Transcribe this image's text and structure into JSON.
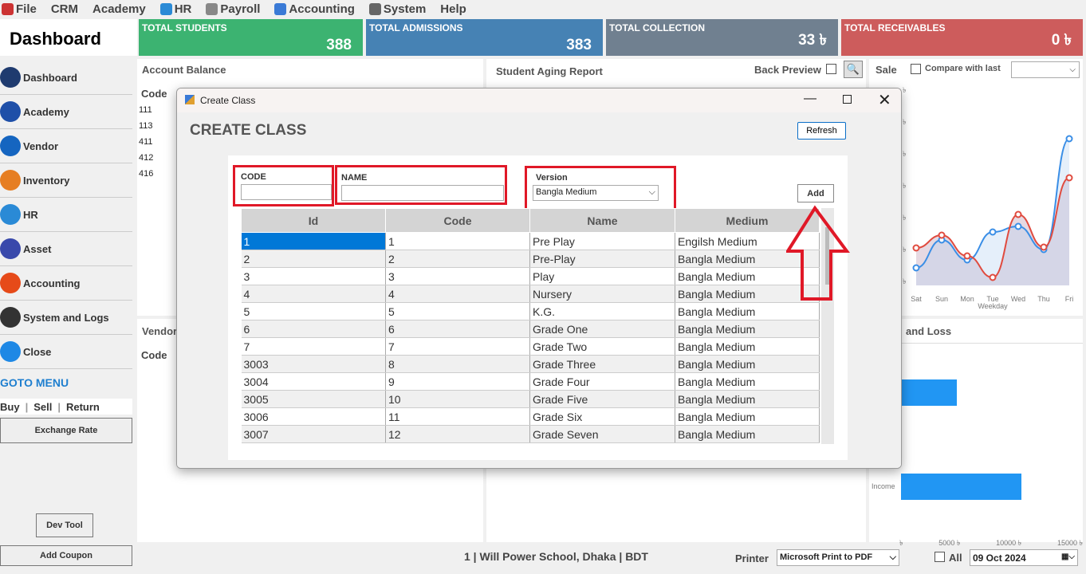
{
  "menu": [
    {
      "label": "File",
      "icon": "file-icon",
      "color": "#c33"
    },
    {
      "label": "CRM",
      "icon": "",
      "color": ""
    },
    {
      "label": "Academy",
      "icon": "",
      "color": ""
    },
    {
      "label": "HR",
      "icon": "hr-icon",
      "color": "#2a8ad6"
    },
    {
      "label": "Payroll",
      "icon": "payroll-icon",
      "color": "#888"
    },
    {
      "label": "Accounting",
      "icon": "accounting-icon",
      "color": "#3a7ad6"
    },
    {
      "label": "System",
      "icon": "system-icon",
      "color": "#666"
    },
    {
      "label": "Help",
      "icon": "",
      "color": ""
    }
  ],
  "dashboard_title": "Dashboard",
  "tiles": [
    {
      "label": "TOTAL STUDENTS",
      "value": "388",
      "color": "#3cb371"
    },
    {
      "label": "TOTAL ADMISSIONS",
      "value": "383",
      "color": "#4682b4"
    },
    {
      "label": "TOTAL COLLECTION",
      "value": "33 ৳",
      "color": "#708090"
    },
    {
      "label": "TOTAL RECEIVABLES",
      "value": "0 ৳",
      "color": "#cd5c5c"
    }
  ],
  "sidebar": [
    {
      "label": "Dashboard",
      "icon": "dashboard-icon",
      "color": "#1f3b6f"
    },
    {
      "label": "Academy",
      "icon": "academy-icon",
      "color": "#1e4fa8"
    },
    {
      "label": "Vendor",
      "icon": "vendor-icon",
      "color": "#1565c0"
    },
    {
      "label": "Inventory",
      "icon": "inventory-icon",
      "color": "#e67e22"
    },
    {
      "label": "HR",
      "icon": "hr-icon",
      "color": "#2a8ad6"
    },
    {
      "label": "Asset",
      "icon": "asset-icon",
      "color": "#3949ab"
    },
    {
      "label": "Accounting",
      "icon": "accounting-icon",
      "color": "#e64a19"
    },
    {
      "label": "System and Logs",
      "icon": "gear-icon",
      "color": "#333"
    },
    {
      "label": "Close",
      "icon": "close-icon",
      "color": "#1e88e5"
    }
  ],
  "goto_menu": "GOTO MENU",
  "goto_links": [
    "Buy",
    "Sell",
    "Return"
  ],
  "exchange_rate": "Exchange Rate",
  "dev_tool": "Dev Tool",
  "add_coupon": "Add Coupon",
  "account_balance": {
    "title": "Account Balance",
    "col": "Code",
    "codes": [
      "111",
      "113",
      "411",
      "412",
      "416"
    ]
  },
  "vendor_panel": {
    "title": "Vendor",
    "col": "Code"
  },
  "aging": {
    "title": "Student Aging Report",
    "back_preview": "Back Preview"
  },
  "sale": {
    "label": "Sale",
    "compare": "Compare with last"
  },
  "chart_weekdays": [
    "Sat",
    "Sun",
    "Mon",
    "Tue",
    "Wed",
    "Thu",
    "Fri"
  ],
  "chart_axis": "Weekday",
  "chart_currency": "৳",
  "profit_loss": {
    "title": "and Loss",
    "income": "Income",
    "ticks": [
      "৳",
      "5000 ৳",
      "10000 ৳",
      "15000 ৳"
    ]
  },
  "status": {
    "company": "1 | Will Power School, Dhaka | BDT",
    "printer_label": "Printer",
    "printer": "Microsoft Print to PDF",
    "all": "All",
    "date": "09 Oct  2024"
  },
  "dialog": {
    "title": "Create Class",
    "heading": "CREATE CLASS",
    "refresh": "Refresh",
    "code_label": "CODE",
    "name_label": "NAME",
    "version_label": "Version",
    "version_value": "Bangla Medium",
    "add": "Add",
    "columns": [
      "Id",
      "Code",
      "Name",
      "Medium"
    ],
    "rows": [
      [
        "1",
        "1",
        "Pre Play",
        "Engilsh Medium"
      ],
      [
        "2",
        "2",
        "Pre-Play",
        "Bangla Medium"
      ],
      [
        "3",
        "3",
        "Play",
        "Bangla Medium"
      ],
      [
        "4",
        "4",
        "Nursery",
        "Bangla Medium"
      ],
      [
        "5",
        "5",
        "K.G.",
        "Bangla Medium"
      ],
      [
        "6",
        "6",
        "Grade One",
        "Bangla Medium"
      ],
      [
        "7",
        "7",
        "Grade Two",
        "Bangla Medium"
      ],
      [
        "3003",
        "8",
        "Grade Three",
        "Bangla Medium"
      ],
      [
        "3004",
        "9",
        "Grade Four",
        "Bangla Medium"
      ],
      [
        "3005",
        "10",
        "Grade Five",
        "Bangla Medium"
      ],
      [
        "3006",
        "11",
        "Grade Six",
        "Bangla Medium"
      ],
      [
        "3007",
        "12",
        "Grade Seven",
        "Bangla Medium"
      ]
    ]
  }
}
